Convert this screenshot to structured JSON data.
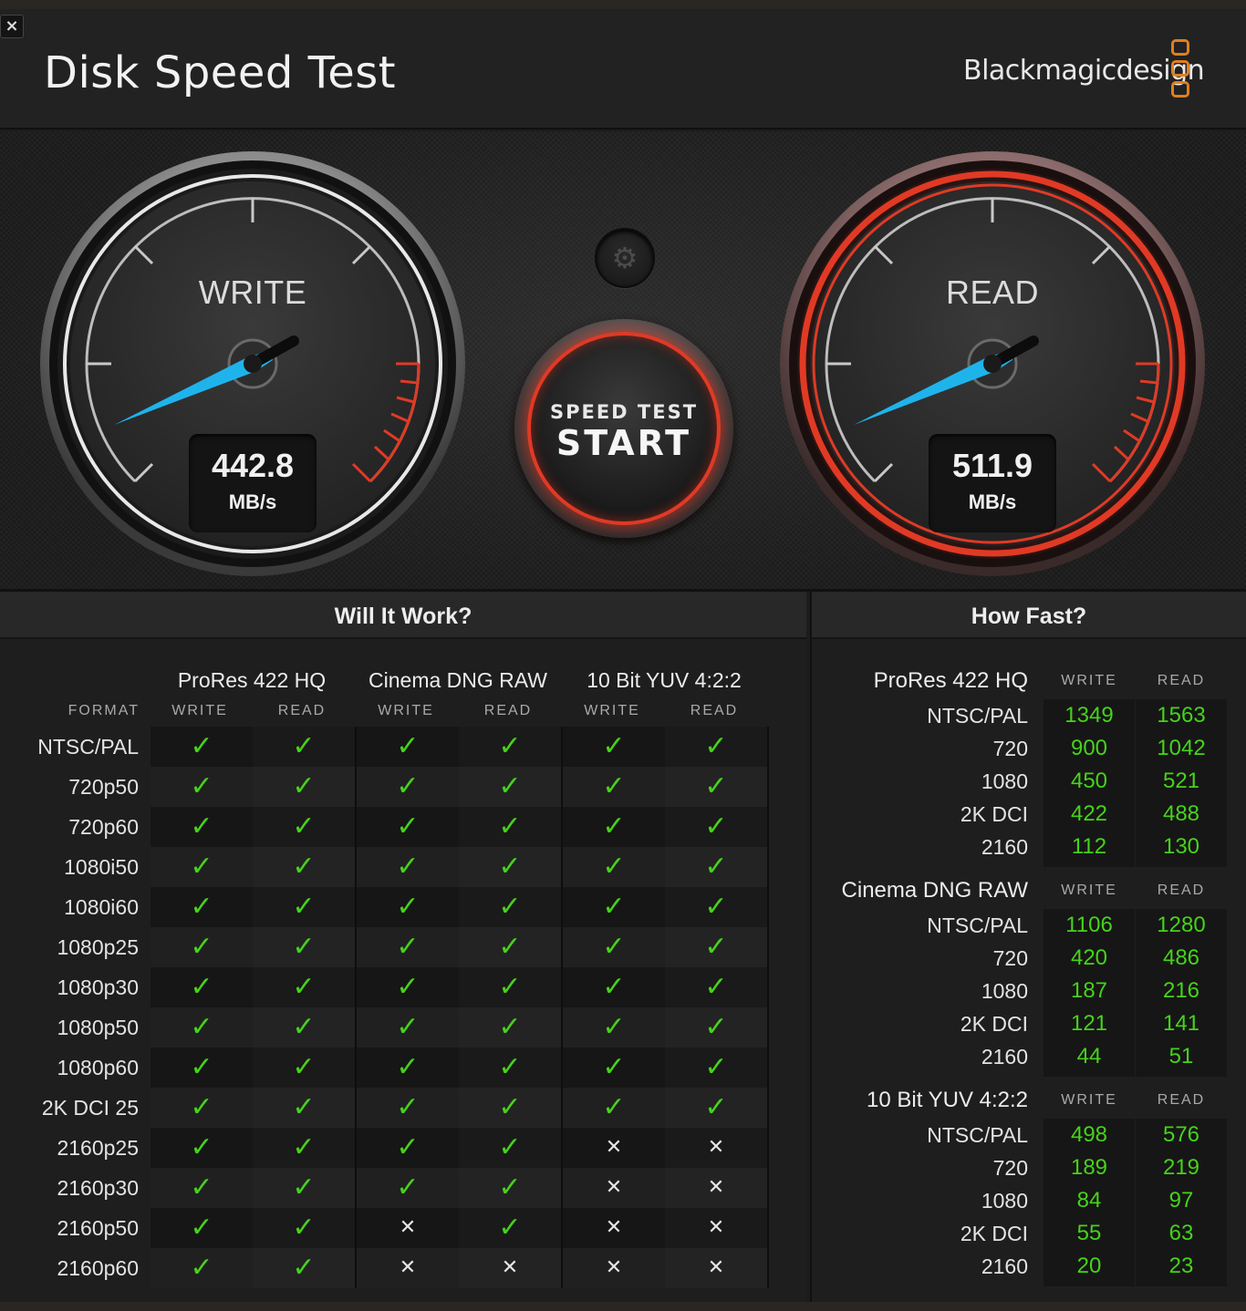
{
  "window": {
    "close_label": "×",
    "title": "Disk Speed Test",
    "brand": "Blackmagicdesign"
  },
  "gauges": {
    "write": {
      "label": "WRITE",
      "value": "442.8",
      "unit": "MB/s"
    },
    "read": {
      "label": "READ",
      "value": "511.9",
      "unit": "MB/s"
    }
  },
  "start_button": {
    "small": "SPEED TEST",
    "big": "START"
  },
  "settings_icon": "gear-icon",
  "will_it_work": {
    "title": "Will It Work?",
    "format_header": "FORMAT",
    "groups": [
      "ProRes 422 HQ",
      "Cinema DNG RAW",
      "10 Bit YUV 4:2:2"
    ],
    "sub_headers": [
      "WRITE",
      "READ",
      "WRITE",
      "READ",
      "WRITE",
      "READ"
    ],
    "rows": [
      {
        "format": "NTSC/PAL",
        "results": [
          1,
          1,
          1,
          1,
          1,
          1
        ]
      },
      {
        "format": "720p50",
        "results": [
          1,
          1,
          1,
          1,
          1,
          1
        ]
      },
      {
        "format": "720p60",
        "results": [
          1,
          1,
          1,
          1,
          1,
          1
        ]
      },
      {
        "format": "1080i50",
        "results": [
          1,
          1,
          1,
          1,
          1,
          1
        ]
      },
      {
        "format": "1080i60",
        "results": [
          1,
          1,
          1,
          1,
          1,
          1
        ]
      },
      {
        "format": "1080p25",
        "results": [
          1,
          1,
          1,
          1,
          1,
          1
        ]
      },
      {
        "format": "1080p30",
        "results": [
          1,
          1,
          1,
          1,
          1,
          1
        ]
      },
      {
        "format": "1080p50",
        "results": [
          1,
          1,
          1,
          1,
          1,
          1
        ]
      },
      {
        "format": "1080p60",
        "results": [
          1,
          1,
          1,
          1,
          1,
          1
        ]
      },
      {
        "format": "2K DCI 25",
        "results": [
          1,
          1,
          1,
          1,
          1,
          1
        ]
      },
      {
        "format": "2160p25",
        "results": [
          1,
          1,
          1,
          1,
          0,
          0
        ]
      },
      {
        "format": "2160p30",
        "results": [
          1,
          1,
          1,
          1,
          0,
          0
        ]
      },
      {
        "format": "2160p50",
        "results": [
          1,
          1,
          0,
          1,
          0,
          0
        ]
      },
      {
        "format": "2160p60",
        "results": [
          1,
          1,
          0,
          0,
          0,
          0
        ]
      }
    ],
    "ok_symbol": "✓",
    "no_symbol": "✕"
  },
  "how_fast": {
    "title": "How Fast?",
    "write_header": "WRITE",
    "read_header": "READ",
    "groups": [
      {
        "name": "ProRes 422 HQ",
        "rows": [
          {
            "label": "NTSC/PAL",
            "write": "1349",
            "read": "1563"
          },
          {
            "label": "720",
            "write": "900",
            "read": "1042"
          },
          {
            "label": "1080",
            "write": "450",
            "read": "521"
          },
          {
            "label": "2K DCI",
            "write": "422",
            "read": "488"
          },
          {
            "label": "2160",
            "write": "112",
            "read": "130"
          }
        ]
      },
      {
        "name": "Cinema DNG RAW",
        "rows": [
          {
            "label": "NTSC/PAL",
            "write": "1106",
            "read": "1280"
          },
          {
            "label": "720",
            "write": "420",
            "read": "486"
          },
          {
            "label": "1080",
            "write": "187",
            "read": "216"
          },
          {
            "label": "2K DCI",
            "write": "121",
            "read": "141"
          },
          {
            "label": "2160",
            "write": "44",
            "read": "51"
          }
        ]
      },
      {
        "name": "10 Bit YUV 4:2:2",
        "rows": [
          {
            "label": "NTSC/PAL",
            "write": "498",
            "read": "576"
          },
          {
            "label": "720",
            "write": "189",
            "read": "219"
          },
          {
            "label": "1080",
            "write": "84",
            "read": "97"
          },
          {
            "label": "2K DCI",
            "write": "55",
            "read": "63"
          },
          {
            "label": "2160",
            "write": "20",
            "read": "23"
          }
        ]
      }
    ]
  },
  "colors": {
    "accent_green": "#46d21b",
    "needle_blue": "#1fb3ec",
    "danger_red": "#e03a25",
    "brand_orange": "#e07f1e"
  }
}
